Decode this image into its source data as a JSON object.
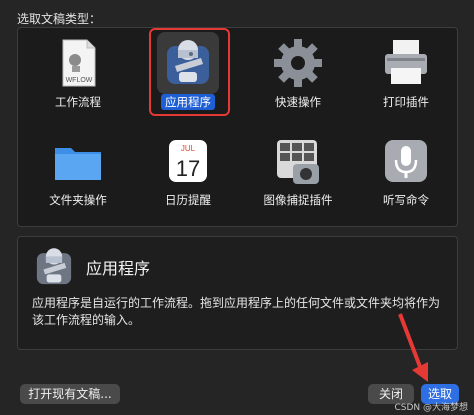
{
  "dialog": {
    "prompt": "选取文稿类型：",
    "items": [
      {
        "label": "工作流程",
        "icon": "workflow-document-icon",
        "caption": "WFLOW"
      },
      {
        "label": "应用程序",
        "icon": "automator-robot-icon",
        "selected": true
      },
      {
        "label": "快速操作",
        "icon": "gear-icon"
      },
      {
        "label": "打印插件",
        "icon": "printer-icon"
      },
      {
        "label": "文件夹操作",
        "icon": "folder-icon"
      },
      {
        "label": "日历提醒",
        "icon": "calendar-icon",
        "month": "JUL",
        "day": "17"
      },
      {
        "label": "图像捕捉插件",
        "icon": "image-capture-icon"
      },
      {
        "label": "听写命令",
        "icon": "microphone-icon"
      }
    ],
    "description": {
      "title": "应用程序",
      "icon": "automator-robot-icon",
      "text": "应用程序是自运行的工作流程。拖到应用程序上的任何文件或文件夹均将作为该工作流程的输入。"
    },
    "buttons": {
      "open_existing": "打开现有文稿...",
      "close": "关闭",
      "choose": "选取"
    },
    "accent_color": "#2f6fe4",
    "highlight_color": "#e53935"
  },
  "watermark": "CSDN @大海梦想"
}
